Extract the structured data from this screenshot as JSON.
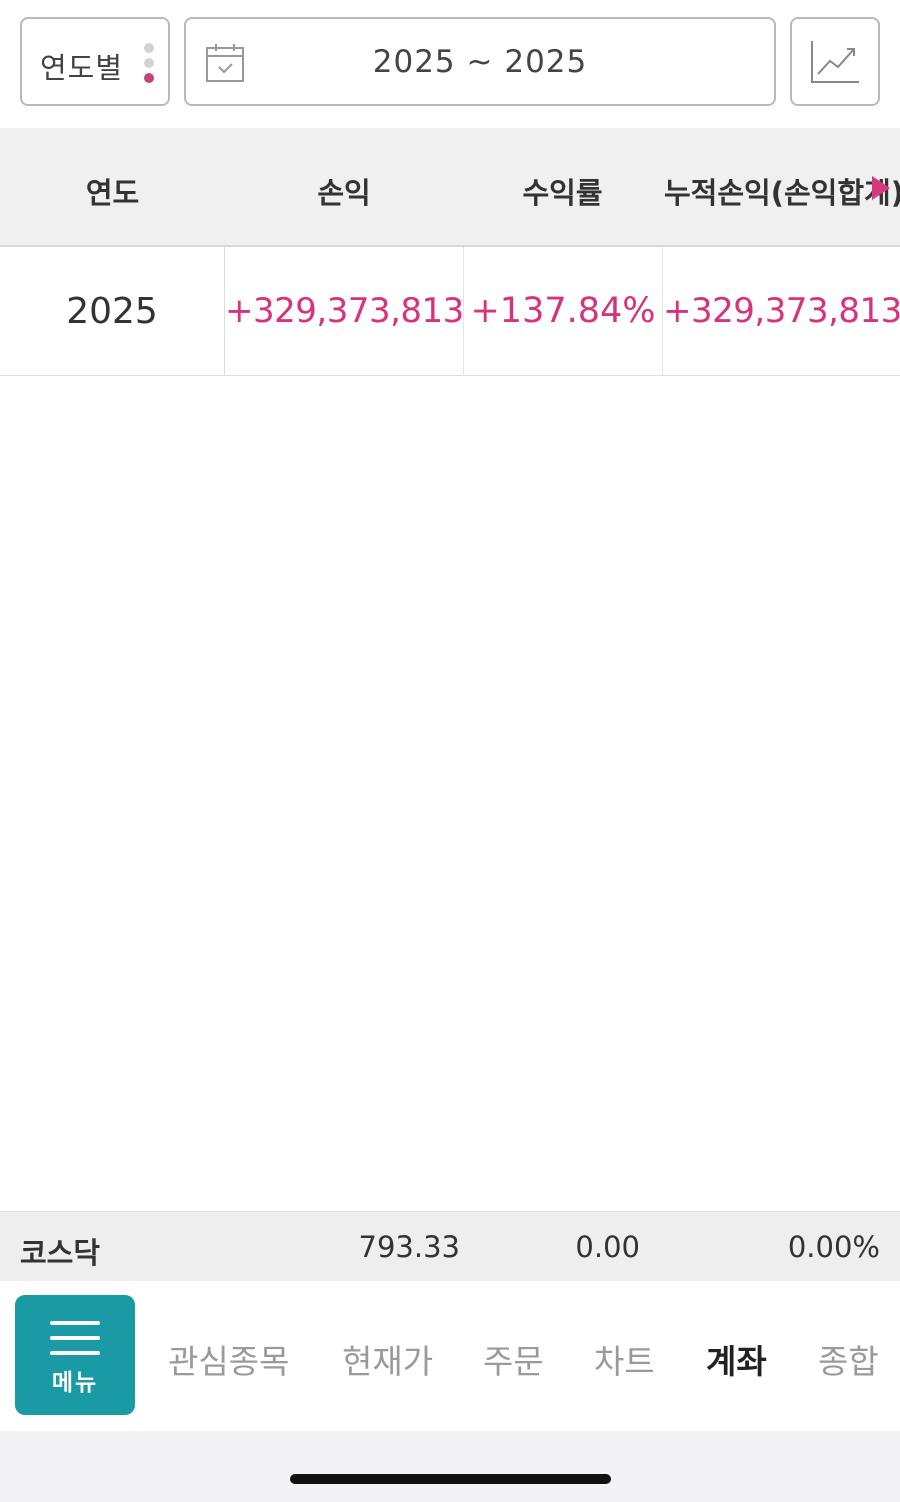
{
  "filter": {
    "period_label": "연도별",
    "date_range": "2025 ~ 2025"
  },
  "table": {
    "headers": [
      "연도",
      "손익",
      "수익률",
      "누적손익(손익합계)"
    ],
    "rows": [
      {
        "year": "2025",
        "profit_loss": "+329,373,813",
        "return_rate": "+137.84%",
        "cumulative": "+329,373,813"
      }
    ]
  },
  "ticker": {
    "name": "코스닥",
    "value": "793.33",
    "change": "0.00",
    "change_pct": "0.00%"
  },
  "nav": {
    "menu_label": "메뉴",
    "items": [
      "관심종목",
      "현재가",
      "주문",
      "차트",
      "계좌",
      "종합"
    ],
    "active": "계좌"
  },
  "colors": {
    "accent": "#d6337a",
    "menu_teal": "#1a9aa4"
  }
}
